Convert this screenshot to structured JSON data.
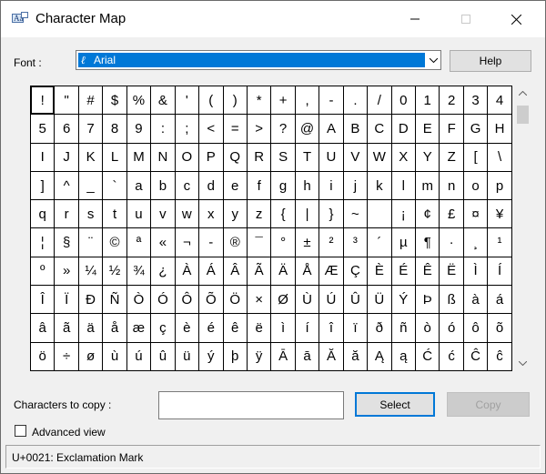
{
  "window": {
    "title": "Character Map",
    "icons": {
      "app": "character-map-icon",
      "minimize": "minimize-icon",
      "maximize": "maximize-icon",
      "close": "close-icon"
    }
  },
  "font": {
    "label": "Font :",
    "selected": "Arial",
    "font_icon": "opentype-font-icon",
    "help_label": "Help"
  },
  "characters": [
    "!",
    "\"",
    "#",
    "$",
    "%",
    "&",
    "'",
    "(",
    ")",
    "*",
    "+",
    ",",
    "-",
    ".",
    "/",
    "0",
    "1",
    "2",
    "3",
    "4",
    "5",
    "6",
    "7",
    "8",
    "9",
    ":",
    ";",
    "<",
    "=",
    ">",
    "?",
    "@",
    "A",
    "B",
    "C",
    "D",
    "E",
    "F",
    "G",
    "H",
    "I",
    "J",
    "K",
    "L",
    "M",
    "N",
    "O",
    "P",
    "Q",
    "R",
    "S",
    "T",
    "U",
    "V",
    "W",
    "X",
    "Y",
    "Z",
    "[",
    "\\",
    "]",
    "^",
    "_",
    "`",
    "a",
    "b",
    "c",
    "d",
    "e",
    "f",
    "g",
    "h",
    "i",
    "j",
    "k",
    "l",
    "m",
    "n",
    "o",
    "p",
    "q",
    "r",
    "s",
    "t",
    "u",
    "v",
    "w",
    "x",
    "y",
    "z",
    "{",
    "|",
    "}",
    "~",
    " ",
    "¡",
    "¢",
    "£",
    "¤",
    "¥",
    "¦",
    "§",
    "¨",
    "©",
    "ª",
    "«",
    "¬",
    "-",
    "®",
    "¯",
    "°",
    "±",
    "²",
    "³",
    "´",
    "µ",
    "¶",
    "·",
    "¸",
    "¹",
    "º",
    "»",
    "¼",
    "½",
    "¾",
    "¿",
    "À",
    "Á",
    "Â",
    "Ã",
    "Ä",
    "Å",
    "Æ",
    "Ç",
    "È",
    "É",
    "Ê",
    "Ë",
    "Ì",
    "Í",
    "Î",
    "Ï",
    "Ð",
    "Ñ",
    "Ò",
    "Ó",
    "Ô",
    "Õ",
    "Ö",
    "×",
    "Ø",
    "Ù",
    "Ú",
    "Û",
    "Ü",
    "Ý",
    "Þ",
    "ß",
    "à",
    "á",
    "â",
    "ã",
    "ä",
    "å",
    "æ",
    "ç",
    "è",
    "é",
    "ê",
    "ë",
    "ì",
    "í",
    "î",
    "ï",
    "ð",
    "ñ",
    "ò",
    "ó",
    "ô",
    "õ",
    "ö",
    "÷",
    "ø",
    "ù",
    "ú",
    "û",
    "ü",
    "ý",
    "þ",
    "ÿ",
    "Ā",
    "ā",
    "Ă",
    "ă",
    "Ą",
    "ą",
    "Ć",
    "ć",
    "Ĉ",
    "ĉ"
  ],
  "selected_index": 0,
  "scrollbar": {
    "up_icon": "scroll-up-arrow-icon",
    "down_icon": "scroll-down-arrow-icon"
  },
  "copy": {
    "label": "Characters to copy :",
    "value": "",
    "select_label": "Select",
    "copy_label": "Copy"
  },
  "advanced": {
    "label": "Advanced view",
    "checked": false
  },
  "status": {
    "text": "U+0021: Exclamation Mark"
  }
}
